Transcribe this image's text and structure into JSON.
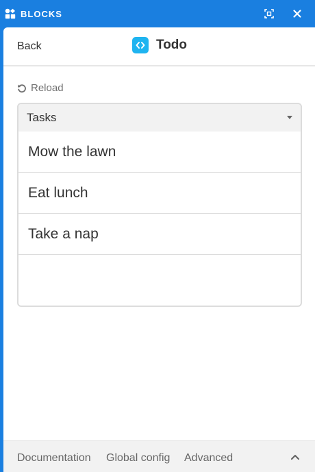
{
  "topbar": {
    "title": "BLOCKS",
    "expand_icon": "expand-icon",
    "close_icon": "close-icon"
  },
  "header": {
    "back_label": "Back",
    "title": "Todo",
    "app_icon": "code-brackets-icon"
  },
  "reload_label": "Reload",
  "tasks": {
    "selected_table": "Tasks",
    "items": [
      "Mow the lawn",
      "Eat lunch",
      "Take a nap"
    ]
  },
  "footer": {
    "links": [
      "Documentation",
      "Global config",
      "Advanced"
    ],
    "collapse_icon": "chevron-up-icon"
  },
  "colors": {
    "topbar": "#1a7fe0",
    "app_icon": "#1fb4f0",
    "panel": "#ffffff"
  }
}
